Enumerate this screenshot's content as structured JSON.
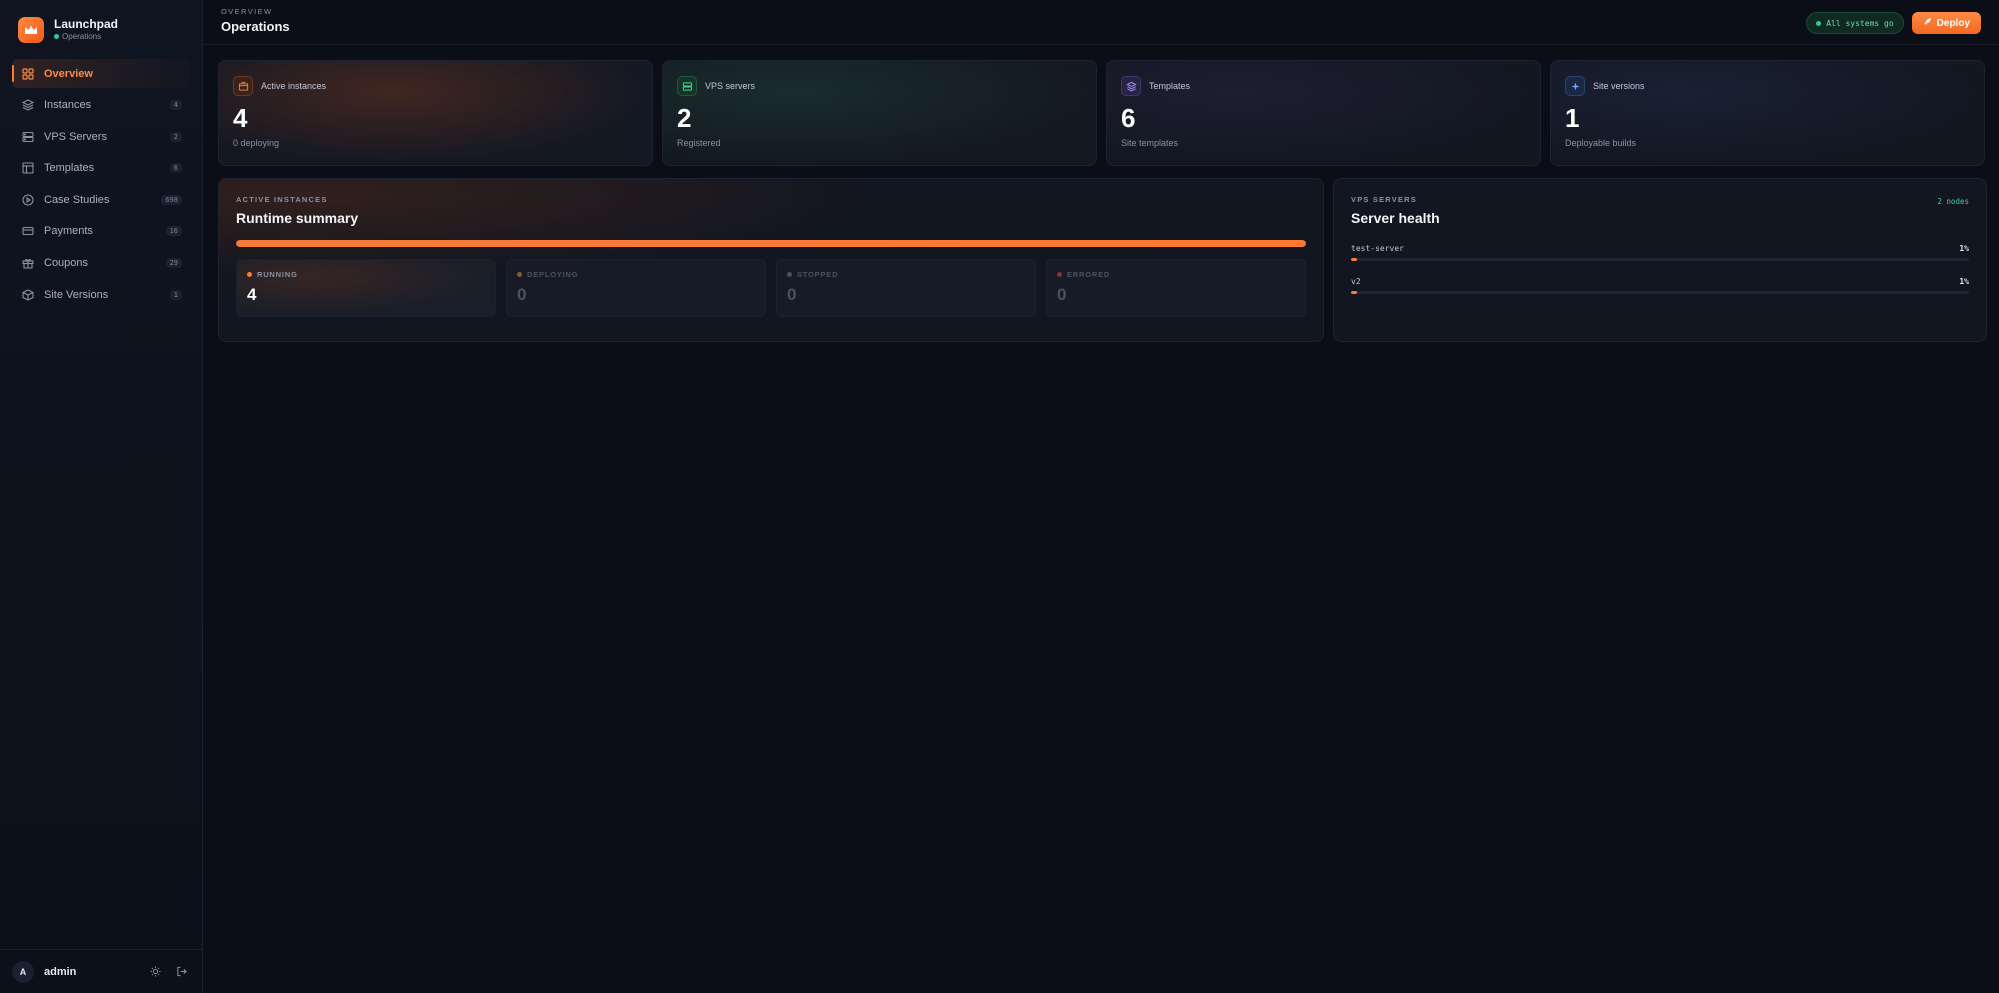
{
  "brand": {
    "name": "Launchpad",
    "subtitle": "Operations"
  },
  "sidebar": {
    "items": [
      {
        "label": "Overview",
        "icon": "grid-icon",
        "count": "",
        "active": true
      },
      {
        "label": "Instances",
        "icon": "layers-icon",
        "count": "4"
      },
      {
        "label": "VPS Servers",
        "icon": "server-icon",
        "count": "2"
      },
      {
        "label": "Templates",
        "icon": "layout-icon",
        "count": "6"
      },
      {
        "label": "Case Studies",
        "icon": "play-circle-icon",
        "count": "698"
      },
      {
        "label": "Payments",
        "icon": "credit-card-icon",
        "count": "16"
      },
      {
        "label": "Coupons",
        "icon": "gift-icon",
        "count": "29"
      },
      {
        "label": "Site Versions",
        "icon": "cube-icon",
        "count": "1"
      }
    ],
    "footer": {
      "avatar_letter": "A",
      "user": "admin"
    }
  },
  "header": {
    "breadcrumb": "OVERVIEW",
    "title": "Operations",
    "status": "All systems go",
    "deploy_label": "Deploy"
  },
  "stats": [
    {
      "label": "Active instances",
      "value": "4",
      "sub": "0 deploying",
      "color": "#f07a3c"
    },
    {
      "label": "VPS servers",
      "value": "2",
      "sub": "Registered",
      "color": "#3fd39a"
    },
    {
      "label": "Templates",
      "value": "6",
      "sub": "Site templates",
      "color": "#a08cf0"
    },
    {
      "label": "Site versions",
      "value": "1",
      "sub": "Deployable builds",
      "color": "#6fa8ff"
    }
  ],
  "runtime": {
    "kicker": "ACTIVE INSTANCES",
    "title": "Runtime summary",
    "progress": 1.0,
    "statuses": [
      {
        "label": "RUNNING",
        "value": "4",
        "color": "#ff7a33"
      },
      {
        "label": "DEPLOYING",
        "value": "0",
        "color": "#c9782f"
      },
      {
        "label": "STOPPED",
        "value": "0",
        "color": "#5b6273"
      },
      {
        "label": "ERRORED",
        "value": "0",
        "color": "#d0584a"
      }
    ]
  },
  "health": {
    "kicker": "VPS SERVERS",
    "title": "Server health",
    "badge": "2 nodes",
    "servers": [
      {
        "name": "test-server",
        "pct": "1%",
        "level": 0.01
      },
      {
        "name": "v2",
        "pct": "1%",
        "level": 0.01
      }
    ]
  },
  "colors": {
    "accent": "#ff7a33",
    "success": "#3fd39a",
    "background": "#0b0e17"
  }
}
